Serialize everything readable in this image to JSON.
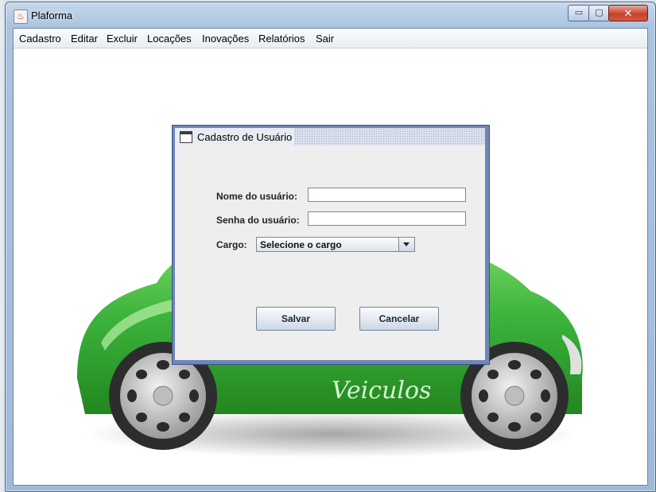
{
  "window": {
    "title": "Plaforma",
    "minimize_glyph": "▭",
    "maximize_glyph": "▢",
    "close_glyph": "✕",
    "icon": "java-cup-icon"
  },
  "menu": {
    "items": [
      {
        "label": "Cadastro"
      },
      {
        "label": "Editar"
      },
      {
        "label": "Excluir"
      },
      {
        "label": "Locações"
      },
      {
        "label": "Inovações"
      },
      {
        "label": "Relatórios"
      },
      {
        "label": "Sair"
      }
    ]
  },
  "background_image": {
    "logo_text": "Veiculos",
    "car_color": "#3cb43c"
  },
  "dialog": {
    "title": "Cadastro de Usuário",
    "username_label": "Nome do usuário:",
    "username_value": "",
    "password_label": "Senha do usuário:",
    "password_value": "",
    "role_label": "Cargo:",
    "role_selected": "Selecione o cargo",
    "save_label": "Salvar",
    "cancel_label": "Cancelar"
  }
}
